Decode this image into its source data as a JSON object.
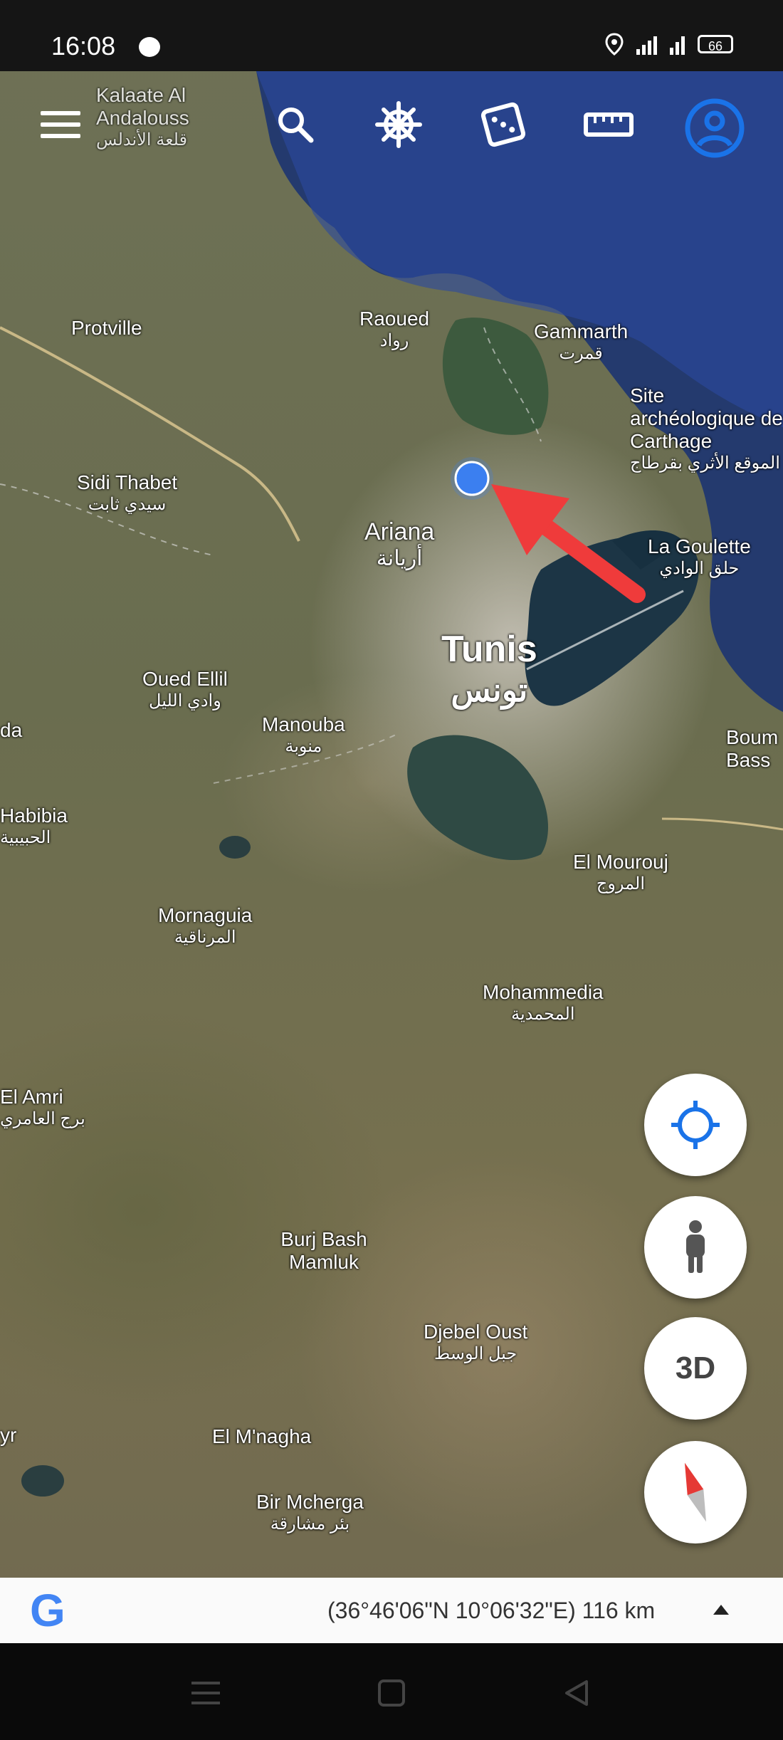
{
  "status_bar": {
    "time": "16:08",
    "battery": "66"
  },
  "toolbar": {
    "icons": [
      "menu-icon",
      "search-icon",
      "voyager-wheel-icon",
      "dice-icon",
      "ruler-icon",
      "account-icon"
    ]
  },
  "map_labels": {
    "kalaat": {
      "en": "Kalaate Al Andalouss",
      "ar": "قلعة الأندلس"
    },
    "protville": {
      "en": "Protville"
    },
    "raoued": {
      "en": "Raoued",
      "ar": "رواد"
    },
    "gammarth": {
      "en": "Gammarth",
      "ar": "قمرت"
    },
    "carthage": {
      "en": "Site archéologique de Carthage",
      "ar": "الموقع الأثري بقرطاج"
    },
    "sidi_thabet": {
      "en": "Sidi Thabet",
      "ar": "سيدي ثابت"
    },
    "ariana": {
      "en": "Ariana",
      "ar": "أريانة"
    },
    "la_goulette": {
      "en": "La Goulette",
      "ar": "حلق الوادي"
    },
    "tunis": {
      "en": "Tunis",
      "ar": "تونس"
    },
    "oued_ellil": {
      "en": "Oued Ellil",
      "ar": "وادي الليل"
    },
    "manouba": {
      "en": "Manouba",
      "ar": "منوبة"
    },
    "nda": {
      "en": "da"
    },
    "habibia": {
      "en": "Habibia",
      "ar": "الحبيبية"
    },
    "boumhel": {
      "en": "Boum Bass"
    },
    "el_mourouj": {
      "en": "El Mourouj",
      "ar": "المروج"
    },
    "mornaguia": {
      "en": "Mornaguia",
      "ar": "المرناقية"
    },
    "mohamedia": {
      "en": "Mohammedia",
      "ar": "المحمدية"
    },
    "el_amri": {
      "en": "El Amri",
      "ar": "برج العامري"
    },
    "burj_bash": {
      "en": "Burj Bash Mamluk"
    },
    "djebel_oust": {
      "en": "Djebel Oust",
      "ar": "جبل الوسط"
    },
    "el_mnagha": {
      "en": "El M'nagha"
    },
    "bir_mcherga": {
      "en": "Bir Mcherga",
      "ar": "بئر مشارقة"
    },
    "yr": {
      "en": "yr"
    }
  },
  "fabs": {
    "three_d_label": "3D"
  },
  "bottom_bar": {
    "coordinates": "(36°46'06\"N 10°06'32\"E) 116 km",
    "logo_letter": "G"
  },
  "colors": {
    "location_dot": "#3b7ff0",
    "arrow": "#ef3b3b",
    "accent": "#1a73e8",
    "sea": "#243a6e"
  }
}
